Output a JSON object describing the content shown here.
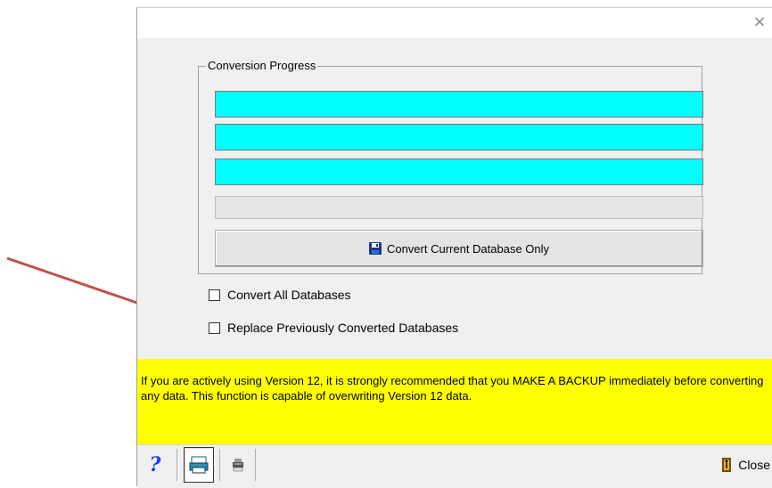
{
  "dialog": {
    "close_glyph": "×"
  },
  "conversion": {
    "group_label": "Conversion Progress",
    "bars": [
      {
        "progress": 1.0
      },
      {
        "progress": 1.0
      },
      {
        "progress": 1.0
      },
      {
        "progress": 0.0
      }
    ],
    "convert_button_label": "Convert Current Database Only",
    "convert_button_icon": "floppy-disk-icon"
  },
  "options": {
    "convert_all_label": "Convert All Databases",
    "convert_all_checked": false,
    "replace_label": "Replace Previously Converted Databases",
    "replace_checked": false
  },
  "warning": {
    "text": "If you are actively using Version 12, it is strongly recommended that you MAKE A BACKUP immediately before converting any data. This function is capable of overwriting Version 12 data."
  },
  "toolbar": {
    "help_glyph": "?",
    "close_label": "Close"
  },
  "colors": {
    "progress_fill": "#00ffff",
    "warning_bg": "#ffff00",
    "arrow": "#c0504d"
  }
}
